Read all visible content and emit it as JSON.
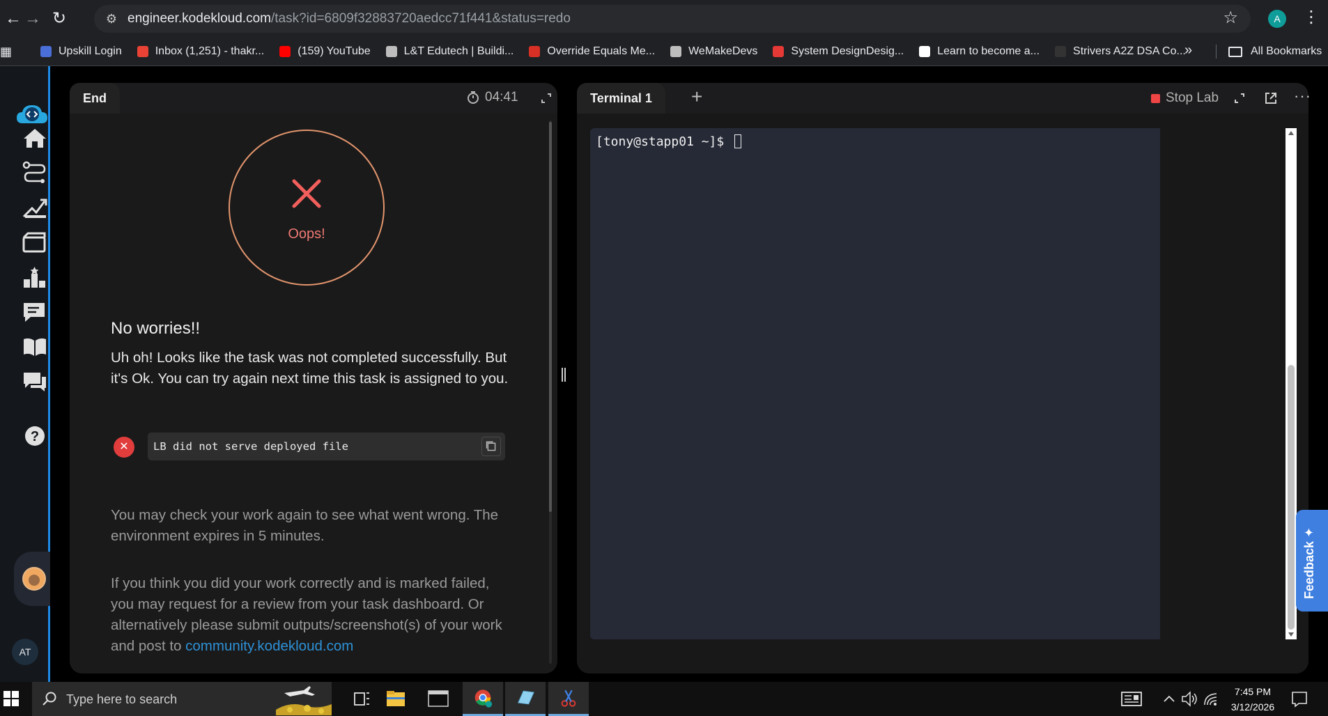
{
  "browser": {
    "url_host": "engineer.kodekloud.com",
    "url_rest": "/task?id=6809f32883720aedcc71f441&status=redo",
    "profile_initial": "A",
    "bookmarks": [
      {
        "label": "Upskill Login",
        "color": "#4a6fd8"
      },
      {
        "label": "Inbox (1,251) - thakr...",
        "color": "#ea4335"
      },
      {
        "label": "(159) YouTube",
        "color": "#ff0000"
      },
      {
        "label": "L&T Edutech | Buildi...",
        "color": "#bdbdbd"
      },
      {
        "label": "Override Equals Me...",
        "color": "#d93025"
      },
      {
        "label": "WeMakeDevs",
        "color": "#bdbdbd"
      },
      {
        "label": "System DesignDesig...",
        "color": "#e53935"
      },
      {
        "label": "Learn to become a...",
        "color": "#ffffff"
      },
      {
        "label": "Strivers A2Z DSA Co...",
        "color": "#333333"
      }
    ],
    "all_bookmarks": "All Bookmarks"
  },
  "left_panel": {
    "tab": "End",
    "timer": "04:41",
    "oops": "Oops!",
    "heading": "No worries!!",
    "message": "Uh oh! Looks like the task was not completed successfully. But it's Ok. You can try again next time this task is assigned to you.",
    "error": "LB did not serve deployed file",
    "check_msg": "You may check your work again to see what went wrong. The environment expires in 5 minutes.",
    "review_msg": "If you think you did your work correctly and is marked failed, you may request for a review from your task dashboard. Or alternatively please submit outputs/screenshot(s) of your work and post to ",
    "community_link": "community.kodekloud.com"
  },
  "right_panel": {
    "tab": "Terminal 1",
    "add": "+",
    "stop_lab": "Stop Lab",
    "prompt": "[tony@stapp01 ~]$ ",
    "more": "···"
  },
  "sidebar": {
    "user_initials": "AT"
  },
  "feedback": "Feedback",
  "taskbar": {
    "search_placeholder": "Type here to search",
    "time": "7:45 PM",
    "date": "3/12/2026"
  }
}
